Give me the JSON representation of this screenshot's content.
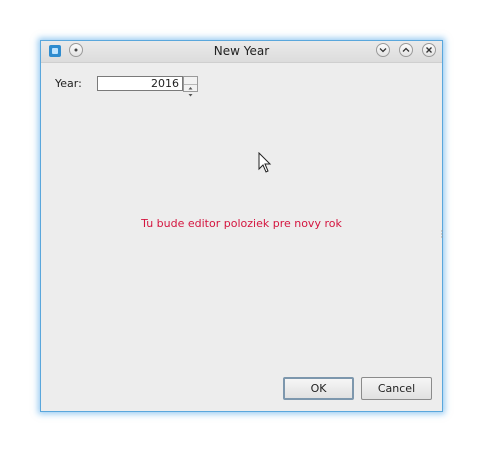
{
  "window": {
    "title": "New Year"
  },
  "form": {
    "year_label": "Year:",
    "year_value": "2016"
  },
  "content": {
    "message": "Tu bude editor poloziek pre novy rok"
  },
  "buttons": {
    "ok_label": "OK",
    "cancel_label": "Cancel"
  },
  "icons": {
    "app": "app-icon",
    "menu": "circle-menu-icon",
    "minimize": "chevron-down-icon",
    "maximize": "chevron-up-icon",
    "close": "close-icon"
  },
  "colors": {
    "message": "#d4153f",
    "window_glow": "#5aa7dc"
  }
}
